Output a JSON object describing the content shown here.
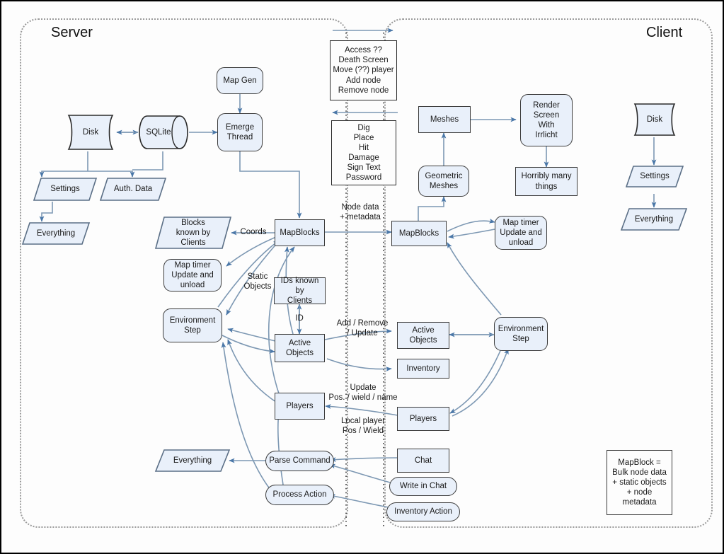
{
  "diagram": {
    "title": "Minetest Server/Client architecture diagram",
    "colors": {
      "node_fill": "#e9f0fa",
      "node_stroke": "#3b3b3b",
      "arrow": "#4a77a8",
      "connector": "#7d98b3",
      "zone_border": "#9a9a9a",
      "page_border": "#000000"
    }
  },
  "zones": [
    {
      "id": "server",
      "label": "Server"
    },
    {
      "id": "client",
      "label": "Client"
    }
  ],
  "server": {
    "nodes": {
      "map_gen": "Map Gen",
      "disk": "Disk",
      "sqlite": "SQLite",
      "emerge_thread": "Emerge\nThread",
      "settings": "Settings",
      "auth_data": "Auth. Data",
      "everything_top": "Everything",
      "blocks_known_by_clients": "Blocks\nknown by\nClients",
      "map_timer": "Map timer\nUpdate and\nunload",
      "environment_step": "Environment\nStep",
      "mapblocks": "MapBlocks",
      "ids_known_by_clients": "IDs known by\nClients",
      "active_objects": "Active\nObjects",
      "players": "Players",
      "everything_bottom": "Everything",
      "parse_command": "Parse Command",
      "process_action": "Process Action"
    },
    "edge_labels": {
      "coords": "Coords",
      "static_objects": "Static\nObjects",
      "id": "ID"
    }
  },
  "client": {
    "nodes": {
      "meshes": "Meshes",
      "render_screen": "Render\nScreen\nWith\nIrrlicht",
      "geometric_meshes": "Geometric\nMeshes",
      "horribly_many_things": "Horribly many\nthings",
      "mapblocks": "MapBlocks",
      "map_timer": "Map timer\nUpdate and\nunload",
      "active_objects": "Active\nObjects",
      "environment_step": "Environment\nStep",
      "inventory": "Inventory",
      "players": "Players",
      "chat": "Chat",
      "write_in_chat": "Write in Chat",
      "inventory_action": "Inventory Action",
      "disk": "Disk",
      "settings": "Settings",
      "everything": "Everything"
    }
  },
  "messages": {
    "to_client_box": "Access ??\nDeath Screen\nMove (??) player\nAdd node\nRemove node",
    "to_server_box": "Dig\nPlace\nHit\nDamage\nSign Text\nPassword"
  },
  "channel_labels": {
    "node_data": "Node data\n+ metadata",
    "add_remove_update": "Add / Remove\n/ Update",
    "update_pos_wield_name": "Update\nPos. / wield / name",
    "local_player_pos_wield": "Local player\nPos / Wield"
  },
  "legend": {
    "mapblock_definition": "MapBlock =\nBulk node data\n+ static objects\n+ node metadata"
  }
}
